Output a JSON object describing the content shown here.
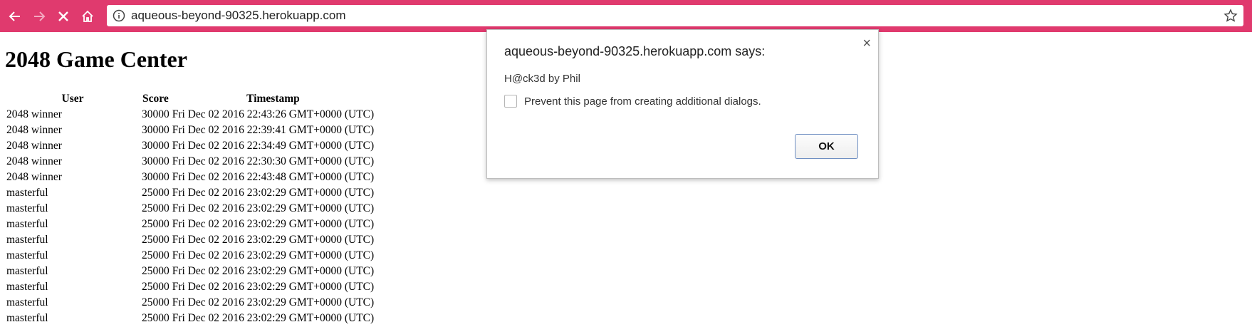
{
  "browser": {
    "url": "aqueous-beyond-90325.herokuapp.com",
    "back_icon": "arrow-left-icon",
    "forward_icon": "arrow-right-icon",
    "stop_icon": "close-icon",
    "home_icon": "home-icon",
    "info_icon": "info-icon",
    "star_icon": "star-icon"
  },
  "page": {
    "title": "2048 Game Center",
    "table": {
      "headers": [
        "User",
        "Score",
        "Timestamp"
      ],
      "rows": [
        {
          "user": "2048 winner",
          "score": "30000",
          "timestamp": "Fri Dec 02 2016 22:43:26 GMT+0000 (UTC)"
        },
        {
          "user": "2048 winner",
          "score": "30000",
          "timestamp": "Fri Dec 02 2016 22:39:41 GMT+0000 (UTC)"
        },
        {
          "user": "2048 winner",
          "score": "30000",
          "timestamp": "Fri Dec 02 2016 22:34:49 GMT+0000 (UTC)"
        },
        {
          "user": "2048 winner",
          "score": "30000",
          "timestamp": "Fri Dec 02 2016 22:30:30 GMT+0000 (UTC)"
        },
        {
          "user": "2048 winner",
          "score": "30000",
          "timestamp": "Fri Dec 02 2016 22:43:48 GMT+0000 (UTC)"
        },
        {
          "user": "masterful",
          "score": "25000",
          "timestamp": "Fri Dec 02 2016 23:02:29 GMT+0000 (UTC)"
        },
        {
          "user": "masterful",
          "score": "25000",
          "timestamp": "Fri Dec 02 2016 23:02:29 GMT+0000 (UTC)"
        },
        {
          "user": "masterful",
          "score": "25000",
          "timestamp": "Fri Dec 02 2016 23:02:29 GMT+0000 (UTC)"
        },
        {
          "user": "masterful",
          "score": "25000",
          "timestamp": "Fri Dec 02 2016 23:02:29 GMT+0000 (UTC)"
        },
        {
          "user": "masterful",
          "score": "25000",
          "timestamp": "Fri Dec 02 2016 23:02:29 GMT+0000 (UTC)"
        },
        {
          "user": "masterful",
          "score": "25000",
          "timestamp": "Fri Dec 02 2016 23:02:29 GMT+0000 (UTC)"
        },
        {
          "user": "masterful",
          "score": "25000",
          "timestamp": "Fri Dec 02 2016 23:02:29 GMT+0000 (UTC)"
        },
        {
          "user": "masterful",
          "score": "25000",
          "timestamp": "Fri Dec 02 2016 23:02:29 GMT+0000 (UTC)"
        },
        {
          "user": "masterful",
          "score": "25000",
          "timestamp": "Fri Dec 02 2016 23:02:29 GMT+0000 (UTC)"
        }
      ]
    }
  },
  "dialog": {
    "title": "aqueous-beyond-90325.herokuapp.com says:",
    "message": "H@ck3d by Phil",
    "checkbox_label": "Prevent this page from creating additional dialogs.",
    "checkbox_checked": false,
    "ok_label": "OK",
    "close_symbol": "×"
  },
  "colors": {
    "toolbar": "#e03a6e",
    "ok_border": "#6f8fc2"
  }
}
